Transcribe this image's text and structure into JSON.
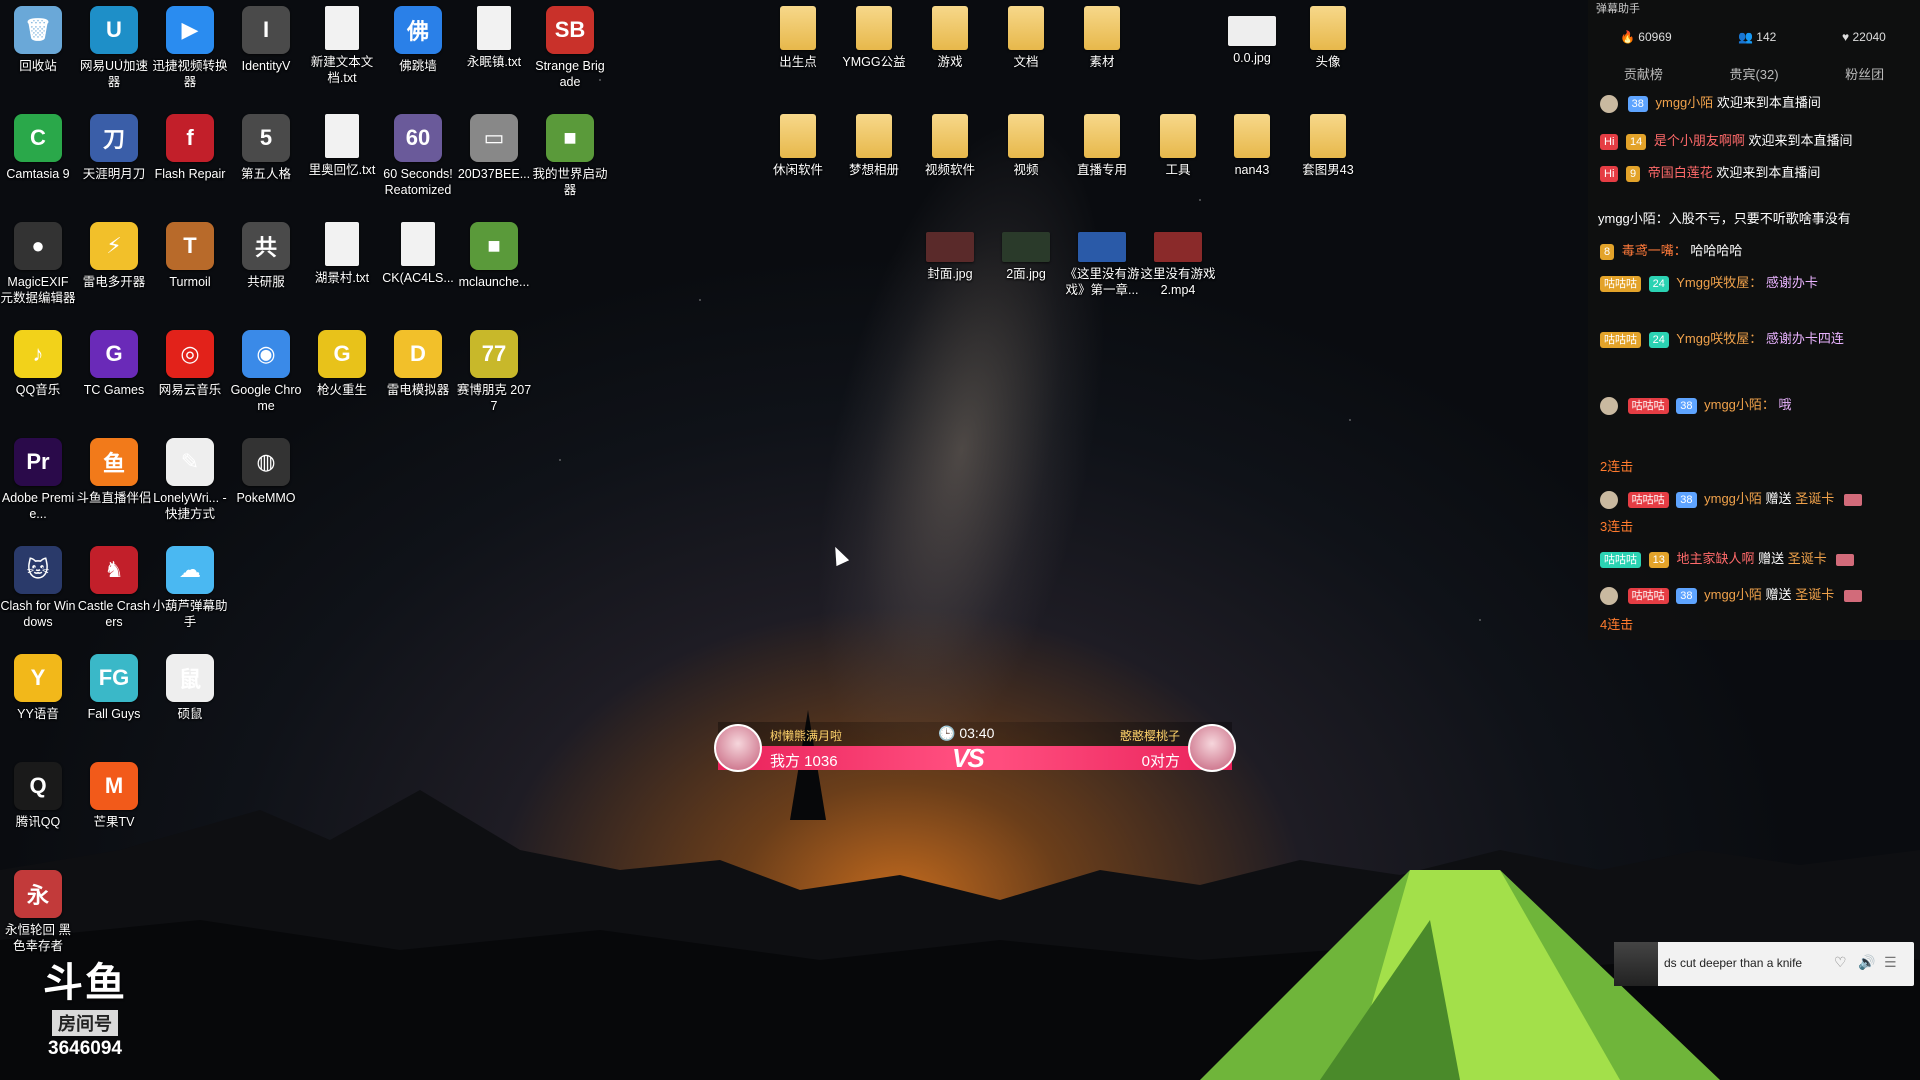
{
  "desktop": {
    "icons": [
      {
        "label": "回收站",
        "glyph": "🗑",
        "color": "#6aa8d8"
      },
      {
        "label": "网易UU加速器",
        "glyph": "U",
        "color": "#1e8fc8"
      },
      {
        "label": "迅捷视频转换器",
        "glyph": "▶",
        "color": "#2a8cf0"
      },
      {
        "label": "IdentityV",
        "glyph": "I",
        "color": "#4a4a4a"
      },
      {
        "label": "新建文本文档.txt",
        "glyph": "",
        "color": "#f2f2f2",
        "kind": "doc"
      },
      {
        "label": "佛跳墙",
        "glyph": "佛",
        "color": "#2a80e8"
      },
      {
        "label": "永眠镇.txt",
        "glyph": "",
        "color": "#f2f2f2",
        "kind": "doc"
      },
      {
        "label": "Strange Brigade",
        "glyph": "SB",
        "color": "#c9312a"
      },
      {
        "label": "Camtasia 9",
        "glyph": "C",
        "color": "#2aa84a"
      },
      {
        "label": "天涯明月刀",
        "glyph": "刀",
        "color": "#3a5ea8"
      },
      {
        "label": "Flash Repair",
        "glyph": "f",
        "color": "#c21f2a"
      },
      {
        "label": "第五人格",
        "glyph": "5",
        "color": "#4a4a4a"
      },
      {
        "label": "里奥回忆.txt",
        "glyph": "",
        "color": "#f2f2f2",
        "kind": "doc"
      },
      {
        "label": "60 Seconds! Reatomized",
        "glyph": "60",
        "color": "#6a5a9a"
      },
      {
        "label": "20D37BEE...",
        "glyph": "▭",
        "color": "#888"
      },
      {
        "label": "我的世界启动器",
        "glyph": "■",
        "color": "#5a9a3a"
      },
      {
        "label": "MagicEXIF 元数据编辑器",
        "glyph": "●",
        "color": "#333"
      },
      {
        "label": "雷电多开器",
        "glyph": "⚡",
        "color": "#f2c02a"
      },
      {
        "label": "Turmoil",
        "glyph": "T",
        "color": "#b86a2a"
      },
      {
        "label": "共研服",
        "glyph": "共",
        "color": "#4a4a4a"
      },
      {
        "label": "湖景村.txt",
        "glyph": "",
        "color": "#f2f2f2",
        "kind": "doc"
      },
      {
        "label": "CK(AC4LS...",
        "glyph": "",
        "color": "#f2f2f2",
        "kind": "doc"
      },
      {
        "label": "mclaunche...",
        "glyph": "■",
        "color": "#5a9a3a"
      },
      {
        "label": "QQ音乐",
        "glyph": "♪",
        "color": "#f2d21a"
      },
      {
        "label": "TC Games",
        "glyph": "G",
        "color": "#6a2ab8"
      },
      {
        "label": "网易云音乐",
        "glyph": "◎",
        "color": "#e2221a"
      },
      {
        "label": "Google Chrome",
        "glyph": "◉",
        "color": "#3a8ae8"
      },
      {
        "label": "枪火重生",
        "glyph": "G",
        "color": "#e8c21a"
      },
      {
        "label": "雷电模拟器",
        "glyph": "D",
        "color": "#f2c02a"
      },
      {
        "label": "赛博朋克 2077",
        "glyph": "77",
        "color": "#c8b82a"
      },
      {
        "label": "Adobe Premie...",
        "glyph": "Pr",
        "color": "#2a0a4a"
      },
      {
        "label": "斗鱼直播伴侣",
        "glyph": "鱼",
        "color": "#f27a1a"
      },
      {
        "label": "LonelyWri... - 快捷方式",
        "glyph": "✎",
        "color": "#eee"
      },
      {
        "label": "PokeMMO",
        "glyph": "◍",
        "color": "#333"
      },
      {
        "label": "Clash for Windows",
        "glyph": "🐱",
        "color": "#2a3a6a"
      },
      {
        "label": "Castle Crashers",
        "glyph": "♞",
        "color": "#c21f2a"
      },
      {
        "label": "小葫芦弹幕助手",
        "glyph": "☁",
        "color": "#4ab8f2"
      },
      {
        "label": "YY语音",
        "glyph": "Y",
        "color": "#f2b81a"
      },
      {
        "label": "Fall Guys",
        "glyph": "FG",
        "color": "#3ab8c8"
      },
      {
        "label": "硕鼠",
        "glyph": "鼠",
        "color": "#eee"
      },
      {
        "label": "腾讯QQ",
        "glyph": "Q",
        "color": "#1a1a1a"
      },
      {
        "label": "芒果TV",
        "glyph": "M",
        "color": "#f25a1a"
      },
      {
        "label": "永恒轮回 黑色幸存者",
        "glyph": "永",
        "color": "#c23a3a"
      }
    ],
    "right_icons": [
      {
        "label": "出生点",
        "kind": "folder"
      },
      {
        "label": "YMGG公益",
        "kind": "folder"
      },
      {
        "label": "游戏",
        "kind": "folder"
      },
      {
        "label": "文档",
        "kind": "folder"
      },
      {
        "label": "素材",
        "kind": "folder"
      },
      {
        "label": "0.0.jpg",
        "kind": "thumb",
        "color": "#eee"
      },
      {
        "label": "头像",
        "kind": "folder"
      },
      {
        "label": "休闲软件",
        "kind": "folder"
      },
      {
        "label": "梦想相册",
        "kind": "folder"
      },
      {
        "label": "视频软件",
        "kind": "folder"
      },
      {
        "label": "视频",
        "kind": "folder"
      },
      {
        "label": "直播专用",
        "kind": "folder"
      },
      {
        "label": "工具",
        "kind": "folder"
      },
      {
        "label": "nan43",
        "kind": "folder"
      },
      {
        "label": "套图男43",
        "kind": "folder"
      },
      {
        "label": "封面.jpg",
        "kind": "thumb",
        "color": "#5a2a2a"
      },
      {
        "label": "2面.jpg",
        "kind": "thumb",
        "color": "#2a3a2a"
      },
      {
        "label": "《这里没有游戏》第一章...",
        "kind": "thumb",
        "color": "#2a5aa8"
      },
      {
        "label": "这里没有游戏2.mp4",
        "kind": "thumb",
        "color": "#8a2a2a"
      }
    ]
  },
  "vs_bar": {
    "left_name": "树懒熊满月啦",
    "right_name": "憨憨樱桃子",
    "timer": "03:40",
    "vs": "VS",
    "left_score": "我方 1036",
    "right_score": "0对方"
  },
  "chat": {
    "title": "弹幕助手",
    "stats": {
      "fire": "60969",
      "people": "142",
      "likes": "22040"
    },
    "tabs": [
      "贡献榜",
      "贵宾(32)",
      "粉丝团"
    ],
    "welcome": [
      {
        "badge": "38",
        "user": "ymgg小陌",
        "text": "欢迎来到本直播间"
      },
      {
        "badge": "14",
        "user": "是个小朋友啊啊",
        "text": "欢迎来到本直播间"
      },
      {
        "badge": "9",
        "user": "帝国白莲花",
        "text": "欢迎来到本直播间"
      }
    ],
    "announce": "ymgg小陌：入股不亏，只要不听歌啥事没有",
    "line2": {
      "badge": "8",
      "user": "毒鸢一嘴：",
      "text": "哈哈哈哈"
    },
    "thanks1": {
      "b1": "咕咕咕",
      "b2": "24",
      "user": "Ymgg咲牧屋：",
      "text": "感谢办卡"
    },
    "thanks2": {
      "b1": "咕咕咕",
      "b2": "24",
      "user": "Ymgg咲牧屋：",
      "text": "感谢办卡四连"
    },
    "thanks3": {
      "b1": "咕咕咕",
      "b2": "38",
      "user": "ymgg小陌：",
      "text": "哦"
    },
    "gifts": [
      {
        "combo": "2连击",
        "b1": "咕咕咕",
        "b2": "38",
        "user": "ymgg小陌",
        "action": "赠送",
        "item": "圣诞卡"
      },
      {
        "combo": "3连击",
        "b1": "咕咕咕",
        "b2": "13",
        "user": "地主家缺人啊",
        "action": "赠送",
        "item": "圣诞卡"
      },
      {
        "combo": "",
        "b1": "咕咕咕",
        "b2": "38",
        "user": "ymgg小陌",
        "action": "赠送",
        "item": "圣诞卡"
      }
    ],
    "last_combo": "4连击"
  },
  "player": {
    "song": "ds cut deeper than a knife"
  },
  "room": {
    "logo": "斗鱼",
    "tag": "房间号",
    "number": "3646094"
  }
}
